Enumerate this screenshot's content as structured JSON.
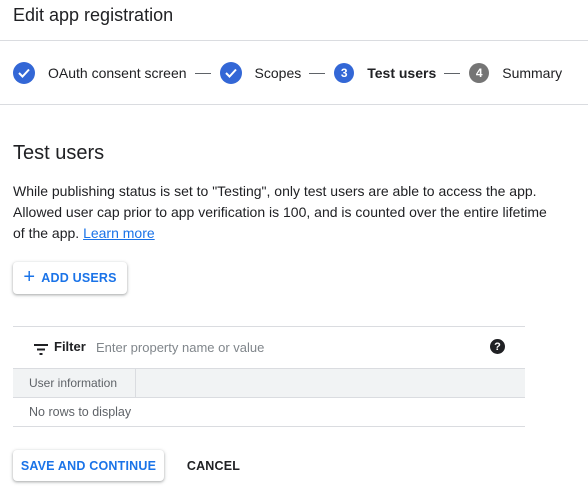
{
  "header": {
    "title": "Edit app registration"
  },
  "stepper": {
    "steps": [
      {
        "label": "OAuth consent screen",
        "status": "completed"
      },
      {
        "label": "Scopes",
        "status": "completed"
      },
      {
        "label": "Test users",
        "status": "current",
        "number": "3"
      },
      {
        "label": "Summary",
        "status": "pending",
        "number": "4"
      }
    ]
  },
  "section": {
    "title": "Test users",
    "description": "While publishing status is set to \"Testing\", only test users are able to access the app. Allowed user cap prior to app verification is 100, and is counted over the entire lifetime of the app.",
    "learn_more": "Learn more"
  },
  "add_users": {
    "label": "ADD USERS",
    "icon": "plus-icon"
  },
  "filter": {
    "label": "Filter",
    "placeholder": "Enter property name or value",
    "help": "?"
  },
  "table": {
    "columns": [
      "User information"
    ],
    "empty_text": "No rows to display"
  },
  "actions": {
    "save_continue": "SAVE AND CONTINUE",
    "cancel": "CANCEL"
  },
  "colors": {
    "accent": "#1a73e8",
    "step_active": "#3367d6",
    "step_pending": "#757575"
  }
}
